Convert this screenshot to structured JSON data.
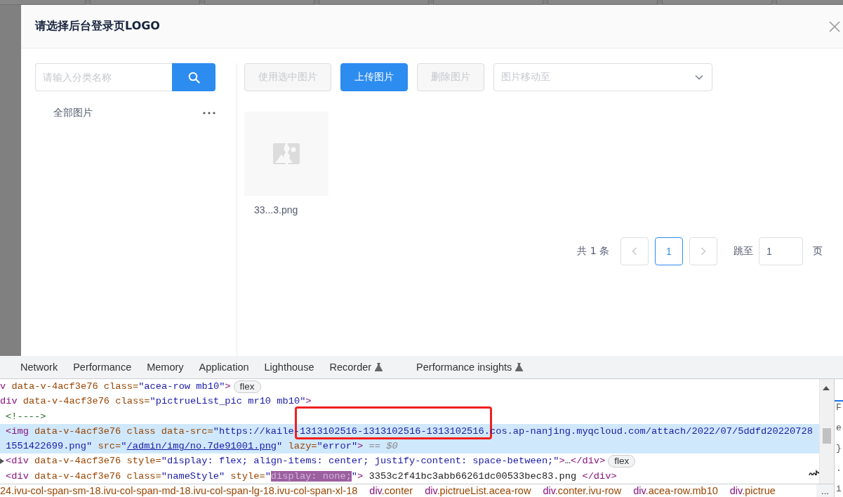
{
  "dialog": {
    "title": "请选择后台登录页LOGO",
    "category_search": {
      "placeholder": "请输入分类名称"
    },
    "categories": [
      {
        "label": "全部图片",
        "selected": false
      }
    ],
    "toolbar": [
      {
        "label": "使用选中图片",
        "kind": "default",
        "disabled": true
      },
      {
        "label": "上传图片",
        "kind": "primary",
        "disabled": false
      },
      {
        "label": "删除图片",
        "kind": "default",
        "disabled": true
      }
    ],
    "move_select": {
      "placeholder": "图片移动至"
    },
    "images": [
      {
        "name": "33...3.png",
        "kind": "broken"
      }
    ],
    "pagination": {
      "total": "共 1 条",
      "prev_disabled": true,
      "pages": [
        {
          "label": "1",
          "selected": true
        }
      ],
      "next_disabled": true,
      "jump_label": "跳至",
      "jump_value": "1",
      "suffix": "页"
    }
  },
  "devtools": {
    "tabs": [
      {
        "label": "Network",
        "experimental": false,
        "selected": false
      },
      {
        "label": "Performance",
        "experimental": false,
        "selected": false
      },
      {
        "label": "Memory",
        "experimental": false,
        "selected": false
      },
      {
        "label": "Application",
        "experimental": false,
        "selected": false
      },
      {
        "label": "Lighthouse",
        "experimental": false,
        "selected": false
      },
      {
        "label": "Recorder",
        "experimental": true,
        "selected": false
      },
      {
        "label": "Performance insights",
        "experimental": true,
        "selected": false
      }
    ],
    "lines": [
      {
        "selected": false,
        "collapsed": false,
        "badge": "flex",
        "tokens": [
          {
            "kind": "tag",
            "text": "v"
          },
          {
            "kind": "attr",
            "text": " data-v-4acf3e76 class="
          },
          {
            "kind": "value",
            "text": "\"acea-row mb10\""
          },
          {
            "kind": "tag",
            "text": ">"
          }
        ]
      },
      {
        "selected": false,
        "collapsed": false,
        "tokens": [
          {
            "kind": "tag",
            "text": "div"
          },
          {
            "kind": "attr",
            "text": " data-v-4acf3e76 class="
          },
          {
            "kind": "value",
            "text": "\"pictrueList_pic mr10 mb10\""
          },
          {
            "kind": "tag",
            "text": ">"
          }
        ],
        "children": [
          {
            "selected": false,
            "collapsed": false,
            "tokens": [
              {
                "kind": "comment",
                "text": "<!---->"
              }
            ]
          },
          {
            "selected": true,
            "collapsed": false,
            "tokens": [
              {
                "kind": "tag",
                "text": "<img"
              },
              {
                "kind": "attr",
                "text": " data-v-4acf3e76 class data-src="
              },
              {
                "kind": "value",
                "text": "\"https://kaile-1313102516-1313102516-1313102516.cos.ap-nanjing.myqcloud.com/attach/2022/07/5ddfd20220728"
              },
              {
                "kind": "break"
              },
              {
                "kind": "value",
                "text": "1551422699.png\""
              },
              {
                "kind": "attr",
                "text": " src="
              },
              {
                "kind": "value",
                "text": "\""
              },
              {
                "kind": "link",
                "text": "/admin/img/no.7de91001.png"
              },
              {
                "kind": "value",
                "text": "\""
              },
              {
                "kind": "attr",
                "text": " lazy="
              },
              {
                "kind": "value",
                "text": "\"error\""
              },
              {
                "kind": "tag",
                "text": ">"
              },
              {
                "kind": "hint",
                "text": " == $0"
              }
            ]
          },
          {
            "selected": false,
            "collapsed": true,
            "badge": "flex",
            "tokens": [
              {
                "kind": "tag",
                "text": "<div"
              },
              {
                "kind": "attr",
                "text": " data-v-4acf3e76 style="
              },
              {
                "kind": "value",
                "text": "\"display: flex; align-items: center; justify-content: space-between;\""
              },
              {
                "kind": "tag",
                "text": ">"
              },
              {
                "kind": "text",
                "text": "…"
              },
              {
                "kind": "tag",
                "text": "</div>"
              }
            ]
          },
          {
            "selected": false,
            "collapsed": false,
            "tokens": [
              {
                "kind": "tag",
                "text": "<div"
              },
              {
                "kind": "attr",
                "text": " data-v-4acf3e76 class="
              },
              {
                "kind": "value",
                "text": "\"nameStyle\""
              },
              {
                "kind": "attr",
                "text": " style="
              },
              {
                "kind": "value",
                "text": "\""
              },
              {
                "kind": "highlight",
                "text": "display: none;"
              },
              {
                "kind": "value",
                "text": "\""
              },
              {
                "kind": "tag",
                "text": ">"
              },
              {
                "kind": "text",
                "text": " 3353c2f41bc3abb66261dc00533bec83.png "
              },
              {
                "kind": "tag",
                "text": "</div>"
              }
            ]
          }
        ]
      }
    ],
    "annotation": {
      "kind": "rectangle"
    },
    "breadcrumbs": [
      {
        "classes": "24.ivu-col-span-sm-18.ivu-col-span-md-18.ivu-col-span-lg-18.ivu-col-span-xl-18"
      },
      {
        "tag": "div",
        "classes": ".conter"
      },
      {
        "tag": "div",
        "classes": ".pictrueList.acea-row"
      },
      {
        "tag": "div",
        "classes": ".conter.ivu-row"
      },
      {
        "tag": "div",
        "classes": ".acea-row.mb10"
      },
      {
        "tag": "div",
        "classes": ".pictrue"
      }
    ],
    "breadcrumb_more": "...",
    "side_panel": [
      "F",
      "e",
      "}",
      ".",
      "i"
    ]
  }
}
